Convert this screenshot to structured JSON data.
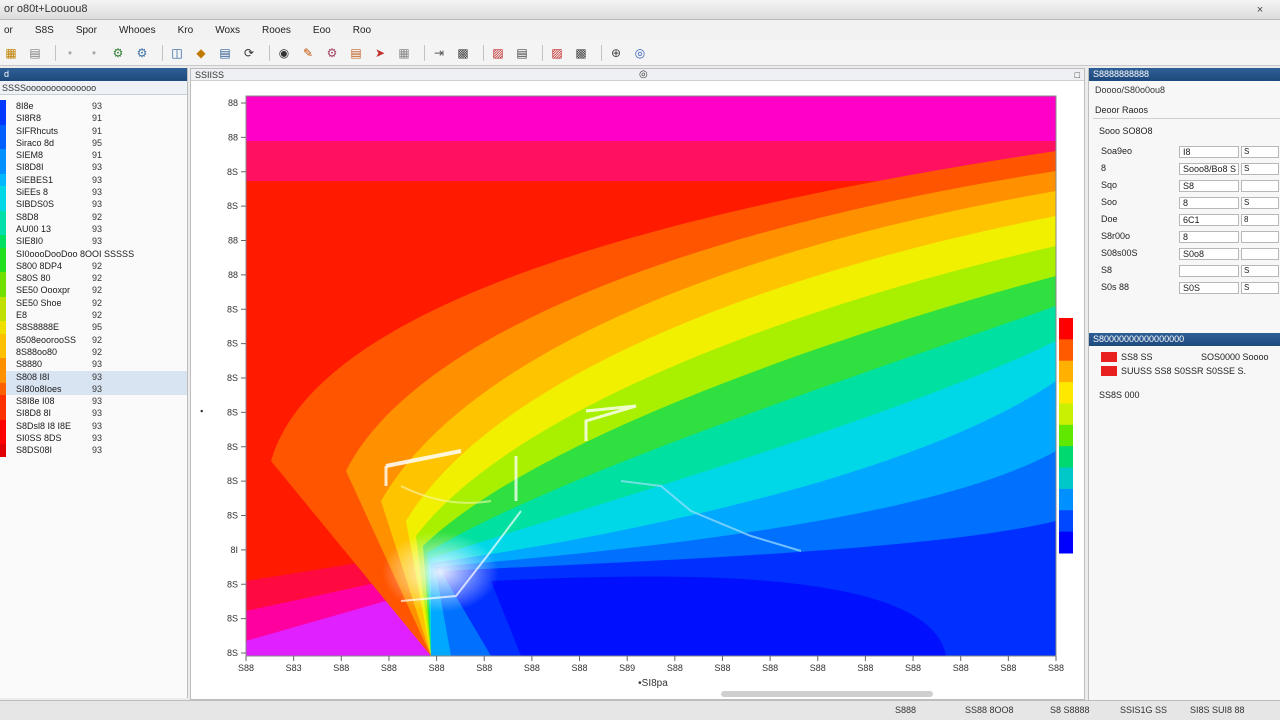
{
  "window": {
    "title": "or o80t+Loouou8",
    "close_label": "×"
  },
  "menu": [
    "or",
    "S8S",
    "Spor",
    "Whooes",
    "Kro",
    "Woxs",
    "Rooes",
    "Eoo",
    "Roo"
  ],
  "toolbar_icons": [
    "grid-icon",
    "layers-icon",
    "dot-icon",
    "dot-icon",
    "gear-icon",
    "gear-icon",
    "open-icon",
    "shape-icon",
    "save-icon",
    "refresh-icon",
    "view-icon",
    "brush-icon",
    "settings-icon",
    "save-icon",
    "pointer-icon",
    "table-icon",
    "export-icon",
    "chart-icon",
    "chart-icon",
    "layer-icon",
    "layer-icon",
    "crosshair-icon",
    "target-icon"
  ],
  "left_panel": {
    "header": "d",
    "subheader": "SSSSoooooooooooooo",
    "swatch_colors": [
      "#0038ff",
      "#0060ff",
      "#0090ff",
      "#00b8ff",
      "#00d8e8",
      "#00e0a8",
      "#00e060",
      "#20e020",
      "#70e000",
      "#c0e000",
      "#f0e000",
      "#ffc000",
      "#ff9000",
      "#ff6000",
      "#ff3000",
      "#ff0000",
      "#e00000"
    ],
    "rows": [
      {
        "name": "8I8e",
        "value": "93"
      },
      {
        "name": "SI8R8",
        "value": "91"
      },
      {
        "name": "SIFRhcuts",
        "value": "91"
      },
      {
        "name": "Siraco 8d",
        "value": "95"
      },
      {
        "name": "SIEM8",
        "value": "91"
      },
      {
        "name": "SI8D8I",
        "value": "93"
      },
      {
        "name": "SiEBES1",
        "value": "93"
      },
      {
        "name": "SiEEs 8",
        "value": "93"
      },
      {
        "name": "SIBDS0S",
        "value": "93"
      },
      {
        "name": "S8D8",
        "value": "92"
      },
      {
        "name": "AU00 13",
        "value": "93"
      },
      {
        "name": "SIE8I0",
        "value": "93"
      },
      {
        "name": "SI0oooDooDoo 8OOI SSSSS",
        "value": ""
      },
      {
        "name": "S800 8DP4",
        "value": "92"
      },
      {
        "name": "S80S 80",
        "value": "92"
      },
      {
        "name": "SE50 Oooxpr",
        "value": "92"
      },
      {
        "name": "SE50 Shoe",
        "value": "92"
      },
      {
        "name": "E8",
        "value": "92"
      },
      {
        "name": "S8S8888E",
        "value": "95"
      },
      {
        "name": "8508eoorooSS",
        "value": "92"
      },
      {
        "name": "8S88oo80",
        "value": "92"
      },
      {
        "name": "S8880",
        "value": "93"
      },
      {
        "name": "S808 I8I",
        "value": "93"
      },
      {
        "name": "SI80o8Ioes",
        "value": "93"
      },
      {
        "name": "S8I8e I08",
        "value": "93"
      },
      {
        "name": "SI8D8 8I",
        "value": "93"
      },
      {
        "name": "S8Dsl8 I8 I8E",
        "value": "93"
      },
      {
        "name": "SI0SS 8DS",
        "value": "93"
      },
      {
        "name": "S8DS08I",
        "value": "93"
      }
    ]
  },
  "center": {
    "header": "SSIISS",
    "xlabel": "•SI8pa",
    "y_ticks": [
      "88",
      "88",
      "8S",
      "8S",
      "88",
      "88",
      "8S",
      "8S",
      "8S",
      "8S",
      "8S",
      "8S",
      "8S",
      "8I",
      "8S",
      "8S",
      "8S"
    ],
    "x_ticks": [
      "S88",
      "S83",
      "S88",
      "S88",
      "S88",
      "S88",
      "S88",
      "S88",
      "S89",
      "S88",
      "S88",
      "S88",
      "S88",
      "S88",
      "S88",
      "S88",
      "S88",
      "S88"
    ],
    "colorbar_colors": [
      "#ff0000",
      "#ff5a00",
      "#ffb000",
      "#ffe800",
      "#c8f000",
      "#60e800",
      "#00d870",
      "#00c8c8",
      "#0090ff",
      "#0048ff",
      "#0000ff"
    ]
  },
  "right_panel": {
    "header": "S8888888888",
    "title": "Doooo/S80o0ou8",
    "sub": "Deoor Raoos",
    "section": "Sooo SO8O8",
    "rows": [
      {
        "label": "Soa9eo",
        "field": "I8",
        "unit": "S"
      },
      {
        "label": "8",
        "field": "Sooo8/Bo8 S",
        "unit": "S"
      },
      {
        "label": "Sqo",
        "field": "S8",
        "unit": ""
      },
      {
        "label": "Soo",
        "field": "8",
        "unit": "S"
      },
      {
        "label": "Doe",
        "field": "6C1",
        "unit": "8"
      },
      {
        "label": "S8r00o",
        "field": "8",
        "unit": ""
      },
      {
        "label": "S08s00S",
        "field": "S0o8",
        "unit": ""
      },
      {
        "label": "S8",
        "field": "",
        "unit": "S"
      },
      {
        "label": "S0s 88",
        "field": "S0S",
        "unit": "S"
      }
    ],
    "section2": "S80000000000000000",
    "legend_items": [
      {
        "label": "SS8 SS",
        "extra": "SOS0000 Soooo",
        "color": "#e82020"
      },
      {
        "label": "SUUSS SS8 S0SSR S0SSE S.",
        "extra": "",
        "color": "#e82020"
      }
    ],
    "footer": "SS8S 000"
  },
  "status": {
    "left": "",
    "items": [
      "S888",
      "SS88 8OO8",
      "S8 S8888",
      "SSIS1G SS",
      "SI8S SUI8 88"
    ]
  }
}
